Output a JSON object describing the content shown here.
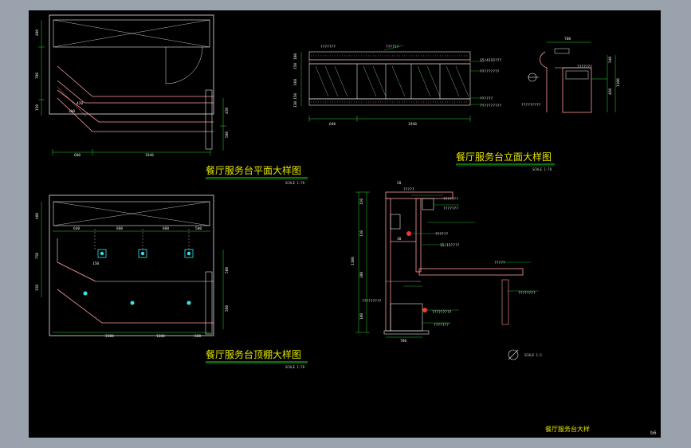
{
  "colors": {
    "canvas": "#9aa3ad",
    "sheet": "#000000",
    "outline": "#e8e8e8",
    "counter": "#ff9a9a",
    "hatch": "#8fdc8f",
    "dimension": "#26d826",
    "title_text": "#e5e500",
    "marker": "#37e3e3"
  },
  "titles": {
    "plan": "餐厅服务台平面大样图",
    "ceiling": "餐厅服务台顶棚大样图",
    "elevation": "餐厅服务台立面大样图",
    "sheet_name": "餐厅服务台大样",
    "page_no": "b6"
  },
  "scales": {
    "plan": "SCALE 1:78",
    "ceiling": "SCALE 1:78",
    "elevation": "SCALE 1:78",
    "section": "SCALE 1:3"
  },
  "plan_dims": {
    "bottom_left": "600",
    "bottom_right": "1940",
    "left_1": "400",
    "left_2": "780",
    "left_3": "150",
    "diag_1": "300",
    "diag_2": "420",
    "right_1": "450",
    "right_2": "580"
  },
  "ceiling_dims": {
    "top_1": "640",
    "top_2": "800",
    "top_3": "800",
    "top_4": "500",
    "bottom_1": "2600",
    "bottom_2": "1600",
    "bottom_3": "600",
    "box_label": "150",
    "left_1": "400",
    "left_2": "750",
    "left_3": "150",
    "right_1": "500",
    "right_2": "580"
  },
  "elevation_dims": {
    "bottom_1": "640",
    "bottom_2": "1940",
    "left_1": "100",
    "left_2": "150",
    "left_3": "660",
    "left_4": "150",
    "left_5": "130",
    "right_top": "700",
    "right_1": "340",
    "right_2": "460",
    "right_3": "1100"
  },
  "elevation_notes": {
    "top": "??????",
    "left": "???????",
    "right_1": "15/4115???",
    "right_2": "?????????",
    "right_3": "??????",
    "right_4": "??????????",
    "side_1": "???????",
    "side_2": "?????????"
  },
  "section_dims": {
    "top": "20",
    "top_2": "15",
    "left_1": "150",
    "left_2": "110",
    "left_3": "380",
    "left_4": "100",
    "total": "1100",
    "left_mid": "30",
    "bottom": "780"
  },
  "section_notes": {
    "n1": "?????",
    "n2": "???????",
    "n3": "???????",
    "n4": "15/15????",
    "n5": "??????",
    "n6": "?????",
    "n7": "????????",
    "n8": "?????????",
    "n9": "?????????",
    "n10": "???????"
  }
}
